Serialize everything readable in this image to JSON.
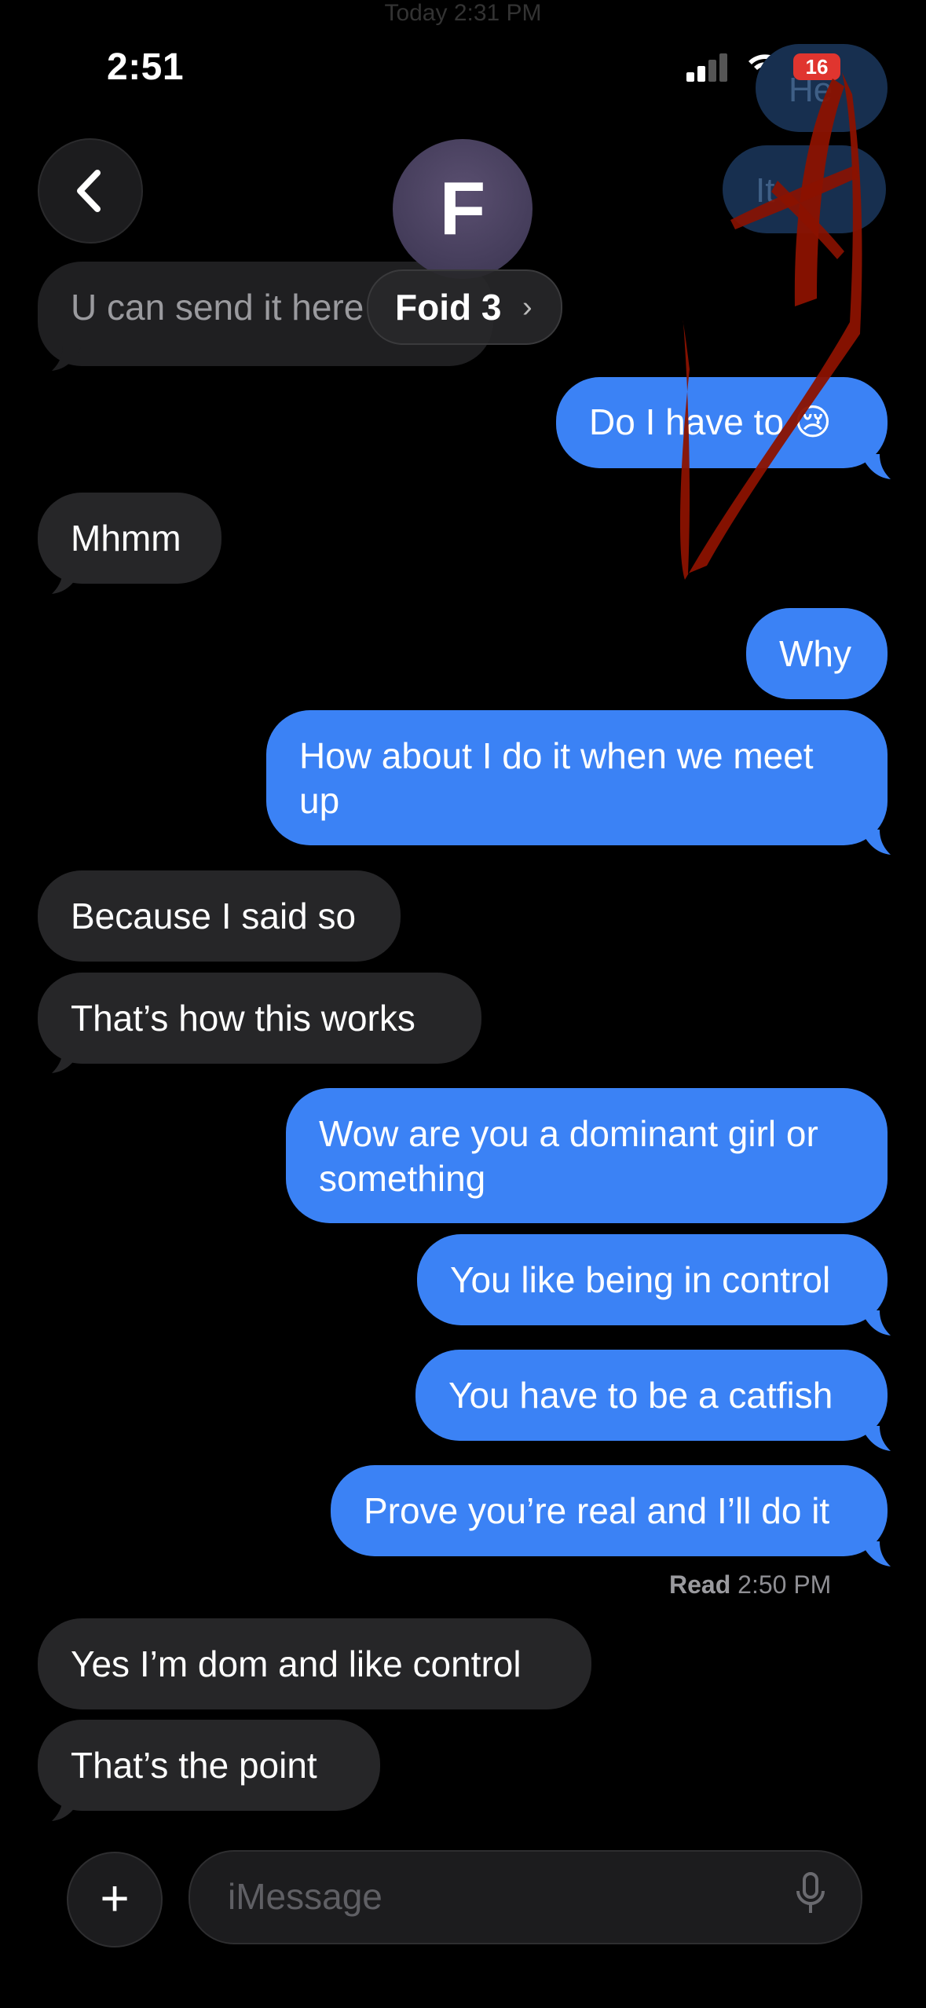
{
  "status_bar": {
    "time": "2:51",
    "battery": "16",
    "faded_header": "Today 2:31 PM"
  },
  "header": {
    "avatar_initial": "F",
    "contact_name": "Foid 3",
    "chevron": "›",
    "ghost_1": "He",
    "ghost_2": "It"
  },
  "messages": [
    {
      "side": "in",
      "text": "U can send it here"
    },
    {
      "side": "out",
      "text": "Do I have to 😢"
    },
    {
      "side": "in",
      "text": "Mhmm"
    },
    {
      "side": "out",
      "text": "Why"
    },
    {
      "side": "out",
      "text": "How about I do it when we meet up"
    },
    {
      "side": "in",
      "text": "Because I said so"
    },
    {
      "side": "in",
      "text": "That’s how this works"
    },
    {
      "side": "out",
      "text": "Wow are you a dominant girl or something"
    },
    {
      "side": "out",
      "text": "You like being in control"
    },
    {
      "side": "out",
      "text": "You have to be a catfish"
    },
    {
      "side": "out",
      "text": "Prove you’re real and I’ll do it"
    },
    {
      "side": "in",
      "text": "Yes I’m dom and like control"
    },
    {
      "side": "in",
      "text": "That’s the point"
    }
  ],
  "read_receipt": {
    "label": "Read",
    "time": "2:50 PM"
  },
  "composer": {
    "placeholder": "iMessage",
    "plus_label": "+"
  },
  "icons": {
    "back": "chevron-left-icon",
    "mic": "microphone-icon",
    "wifi": "wifi-icon",
    "signal": "cellular-signal-icon"
  },
  "colors": {
    "outgoing": "#3b82f5",
    "incoming": "#262628",
    "background": "#000000",
    "scribble": "#8b1200"
  }
}
